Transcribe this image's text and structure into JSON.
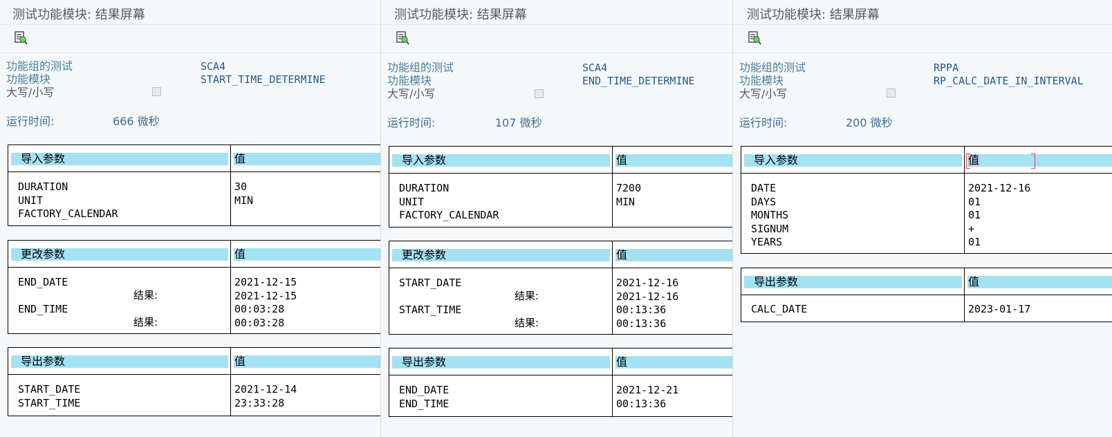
{
  "panels": [
    {
      "title": "测试功能模块: 结果屏幕",
      "icon": "test-sequence-icon",
      "labels": {
        "fg": "功能组的测试",
        "fm": "功能模块",
        "case": "大写/小写"
      },
      "fg_value": "SCA4",
      "fm_value": "START_TIME_DETERMINE",
      "runtime_label": "运行时间:",
      "runtime_value": "666 微秒",
      "import": {
        "header": "导入参数",
        "value_header": "值",
        "names": "DURATION\nUNIT\nFACTORY_CALENDAR",
        "values": "30\nMIN"
      },
      "changing": {
        "header": "更改参数",
        "value_header": "值",
        "names": "END_DATE\n\nEND_TIME",
        "results": "结果:\n\n结果:",
        "values": "2021-12-15\n2021-12-15\n00:03:28\n00:03:28"
      },
      "export": {
        "header": "导出参数",
        "value_header": "值",
        "names": "START_DATE\nSTART_TIME",
        "values": "2021-12-14\n23:33:28"
      }
    },
    {
      "title": "测试功能模块: 结果屏幕",
      "icon": "test-sequence-icon",
      "labels": {
        "fg": "功能组的测试",
        "fm": "功能模块",
        "case": "大写/小写"
      },
      "fg_value": "SCA4",
      "fm_value": "END_TIME_DETERMINE",
      "runtime_label": "运行时间:",
      "runtime_value": "107 微秒",
      "import": {
        "header": "导入参数",
        "value_header": "值",
        "names": "DURATION\nUNIT\nFACTORY_CALENDAR",
        "values": "7200\nMIN"
      },
      "changing": {
        "header": "更改参数",
        "value_header": "值",
        "names": "START_DATE\n\nSTART_TIME",
        "results": "结果:\n\n结果:",
        "values": "2021-12-16\n2021-12-16\n00:13:36\n00:13:36"
      },
      "export": {
        "header": "导出参数",
        "value_header": "值",
        "names": "END_DATE\nEND_TIME",
        "values": "2021-12-21\n00:13:36"
      }
    },
    {
      "title": "测试功能模块: 结果屏幕",
      "icon": "test-sequence-icon",
      "labels": {
        "fg": "功能组的测试",
        "fm": "功能模块",
        "case": "大写/小写"
      },
      "fg_value": "RPPA",
      "fm_value": "RP_CALC_DATE_IN_INTERVAL",
      "runtime_label": "运行时间:",
      "runtime_value": "200 微秒",
      "import": {
        "header": "导入参数",
        "value_header": "值",
        "names": "DATE\nDAYS\nMONTHS\nSIGNUM\nYEARS",
        "values": "2021-12-16\n01\n01\n+\n01"
      },
      "export": {
        "header": "导出参数",
        "value_header": "值",
        "names": "CALC_DATE",
        "values": "2023-01-17"
      }
    }
  ]
}
